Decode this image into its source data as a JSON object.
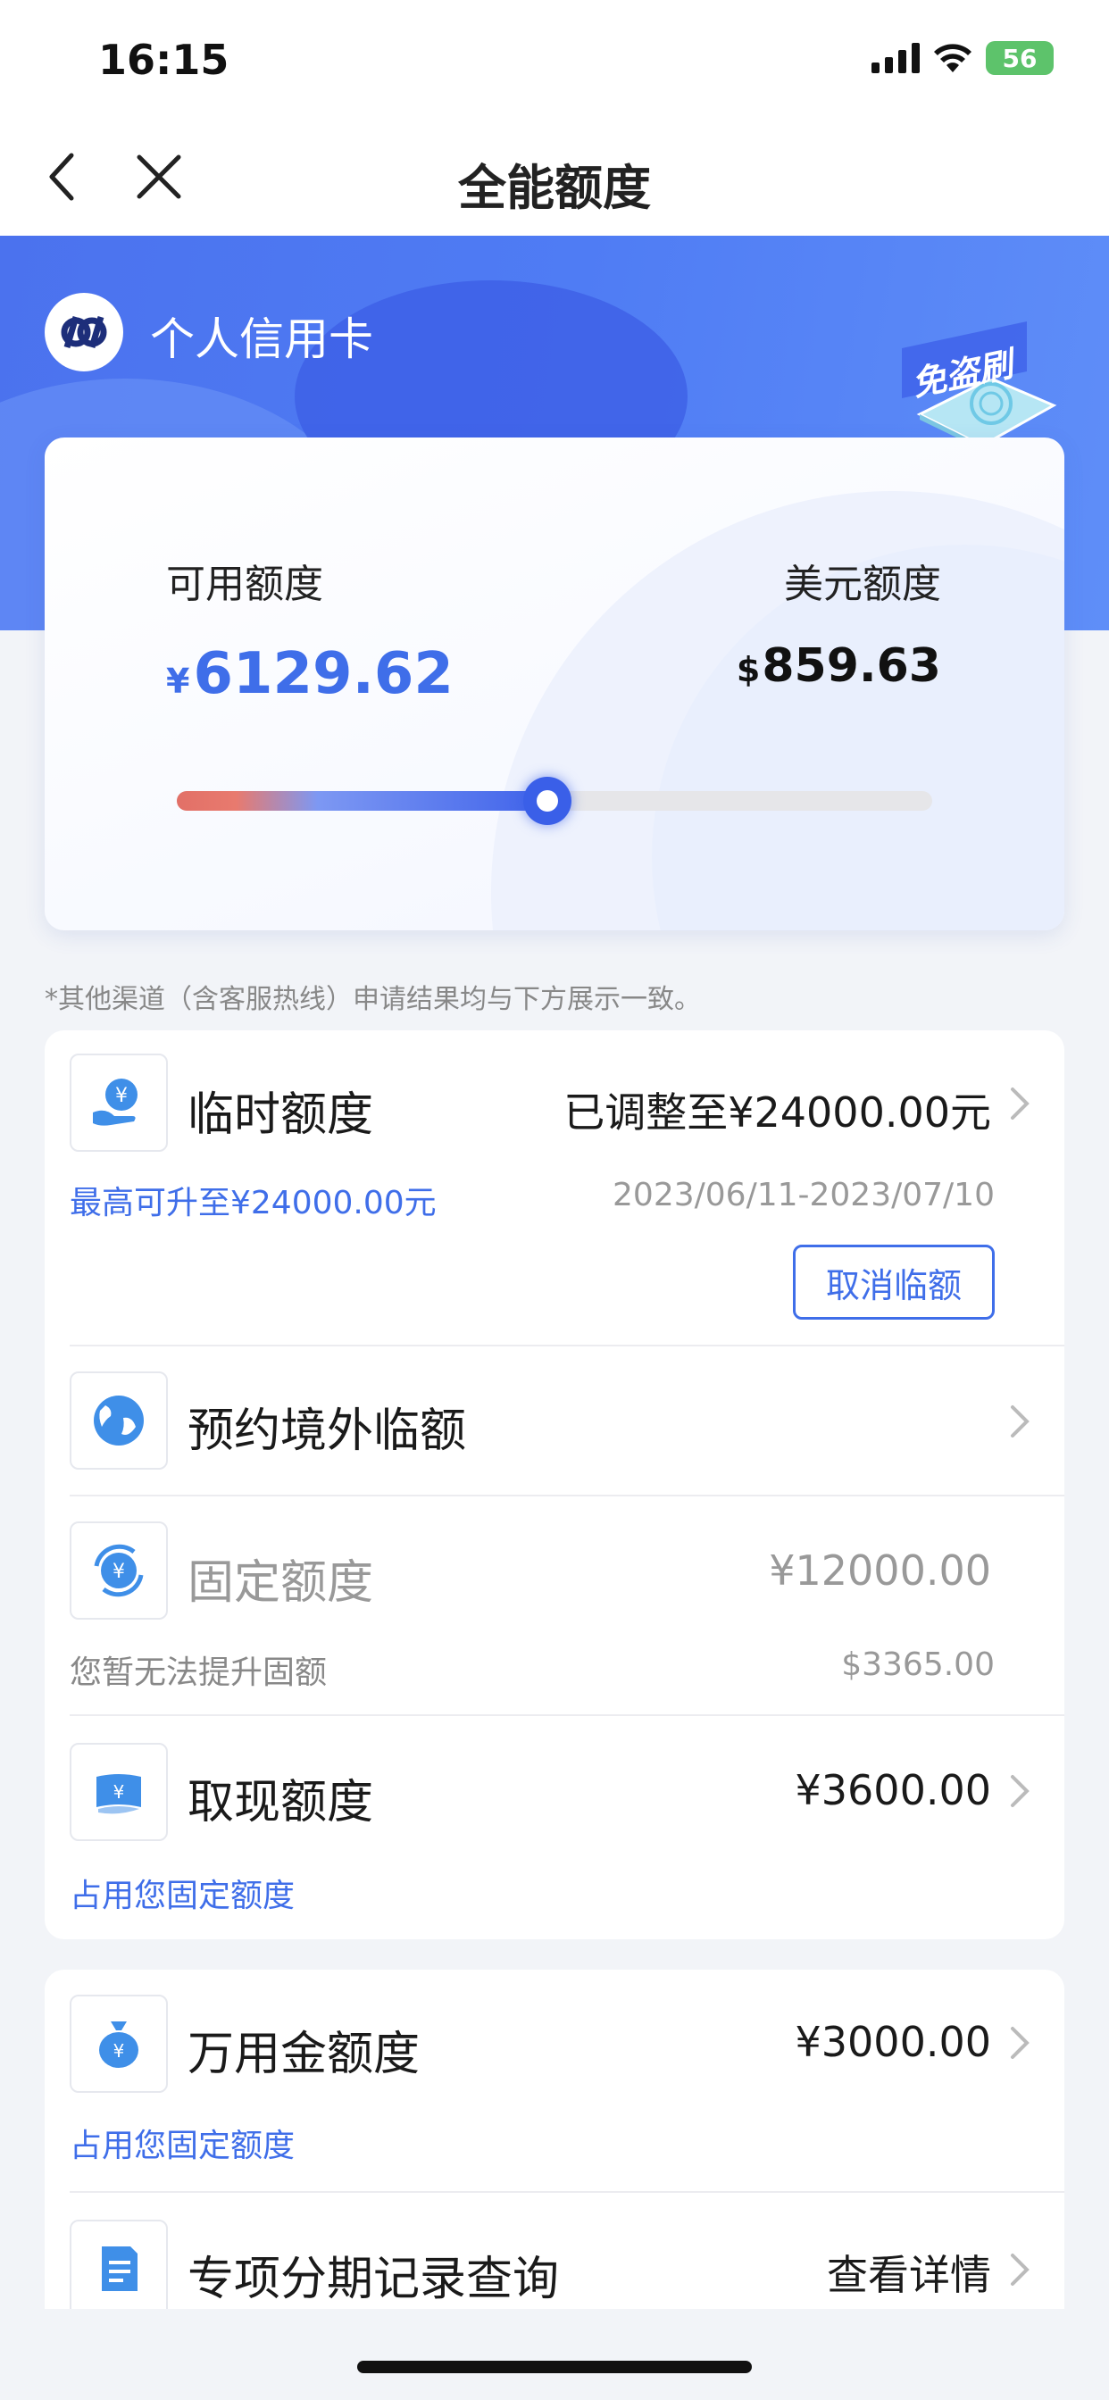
{
  "status_bar": {
    "time": "16:15",
    "battery": "56"
  },
  "nav": {
    "title": "全能额度"
  },
  "banner": {
    "bank_name": "个人信用卡",
    "badge_text": "免盗刷"
  },
  "quota": {
    "available_label": "可用额度",
    "available_currency": "¥",
    "available_value": "6129.62",
    "usd_label": "美元额度",
    "usd_currency": "$",
    "usd_value": "859.63",
    "usage_fraction": 0.49
  },
  "notice": "*其他渠道（含客服热线）申请结果均与下方展示一致。",
  "temporary": {
    "title": "临时额度",
    "value": "已调整至¥24000.00元",
    "max_text": "最高可升至¥24000.00元",
    "date_range": "2023/06/11-2023/07/10",
    "cancel_label": "取消临额"
  },
  "overseas": {
    "title": "预约境外临额"
  },
  "fixed": {
    "title": "固定额度",
    "value": "¥12000.00",
    "sub_text": "您暂无法提升固额",
    "usd_value": "$3365.00"
  },
  "cash": {
    "title": "取现额度",
    "value": "¥3600.00",
    "sub_text": "占用您固定额度"
  },
  "wanyongjin": {
    "title": "万用金额度",
    "value": "¥3000.00",
    "sub_text": "占用您固定额度"
  },
  "installment": {
    "title": "专项分期记录查询",
    "value": "查看详情"
  },
  "colors": {
    "accent": "#3f6ee9",
    "banner": "#4f7cf4",
    "warning": "#e27067"
  }
}
